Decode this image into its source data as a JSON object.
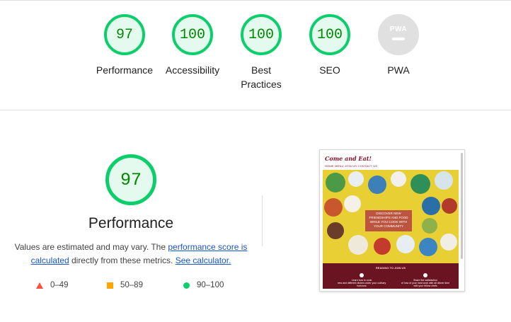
{
  "gauges": [
    {
      "score": "97",
      "label": "Performance"
    },
    {
      "score": "100",
      "label": "Accessibility"
    },
    {
      "score": "100",
      "label": "Best Practices"
    },
    {
      "score": "100",
      "label": "SEO"
    },
    {
      "score": "PWA",
      "label": "PWA"
    }
  ],
  "performance": {
    "score": "97",
    "title": "Performance",
    "desc_part1": "Values are estimated and may vary. The ",
    "link1": "performance score is calculated",
    "desc_part2": " directly from these metrics. ",
    "link2": "See calculator."
  },
  "legend": {
    "fail": "0–49",
    "average": "50–89",
    "pass": "90–100"
  },
  "screenshot": {
    "logo": "Come and Eat!",
    "nav": "HOME   MENU   JOIN US   CONTACT US",
    "overlay": "DISCOVER NEW FRIENDSHIPS AND FOOD WHILE YOU COOK WITH YOUR COMMUNITY",
    "cta": "READING TO JOIN US",
    "col1_title": "Learn how to cook",
    "col1_text": "new and different dishes under your culinary horizons",
    "col2_title": "Share the satisfaction",
    "col2_text": "of how of your hard work with all dinner time with your fellow chefs"
  },
  "colors": {
    "pass": "#0cce6b",
    "pass_bg": "#e5faef",
    "pass_text": "#008800",
    "average": "#ffa400",
    "fail": "#ff4e42",
    "link": "#1a56c4"
  }
}
